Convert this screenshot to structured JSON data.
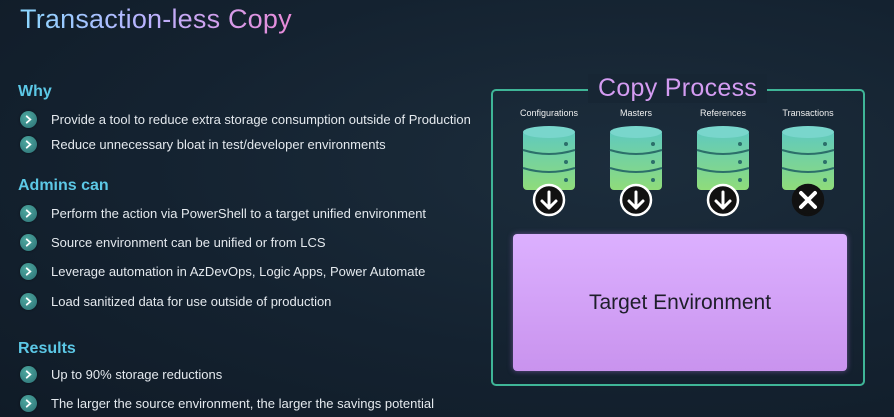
{
  "slide": {
    "title": "Transaction-less Copy"
  },
  "why": {
    "heading": "Why",
    "bullets": [
      "Provide a tool to reduce extra storage consumption outside of Production",
      "Reduce unnecessary bloat in test/developer environments"
    ]
  },
  "admins": {
    "heading": "Admins can",
    "bullets": [
      "Perform the action via PowerShell to a target unified environment",
      "Source environment can be unified or from LCS",
      "Leverage automation in AzDevOps, Logic Apps, Power Automate",
      "Load sanitized data for use outside of production"
    ]
  },
  "results": {
    "heading": "Results",
    "bullets": [
      "Up to 90% storage reductions",
      "The larger the source environment, the larger the savings potential"
    ]
  },
  "copy_process": {
    "title": "Copy Process",
    "databases": [
      {
        "label": "Configurations",
        "icon": "down-arrow-icon"
      },
      {
        "label": "Masters",
        "icon": "down-arrow-icon"
      },
      {
        "label": "References",
        "icon": "down-arrow-icon"
      },
      {
        "label": "Transactions",
        "icon": "x-icon"
      }
    ],
    "target_label": "Target Environment"
  },
  "colors": {
    "heading": "#5cc8e6",
    "panel_border": "#3fb597",
    "panel_title": "#d49cf2",
    "db_teal": "#5ec9c0",
    "db_green": "#8fdc7a",
    "target_fill": "#d3a6f8"
  }
}
